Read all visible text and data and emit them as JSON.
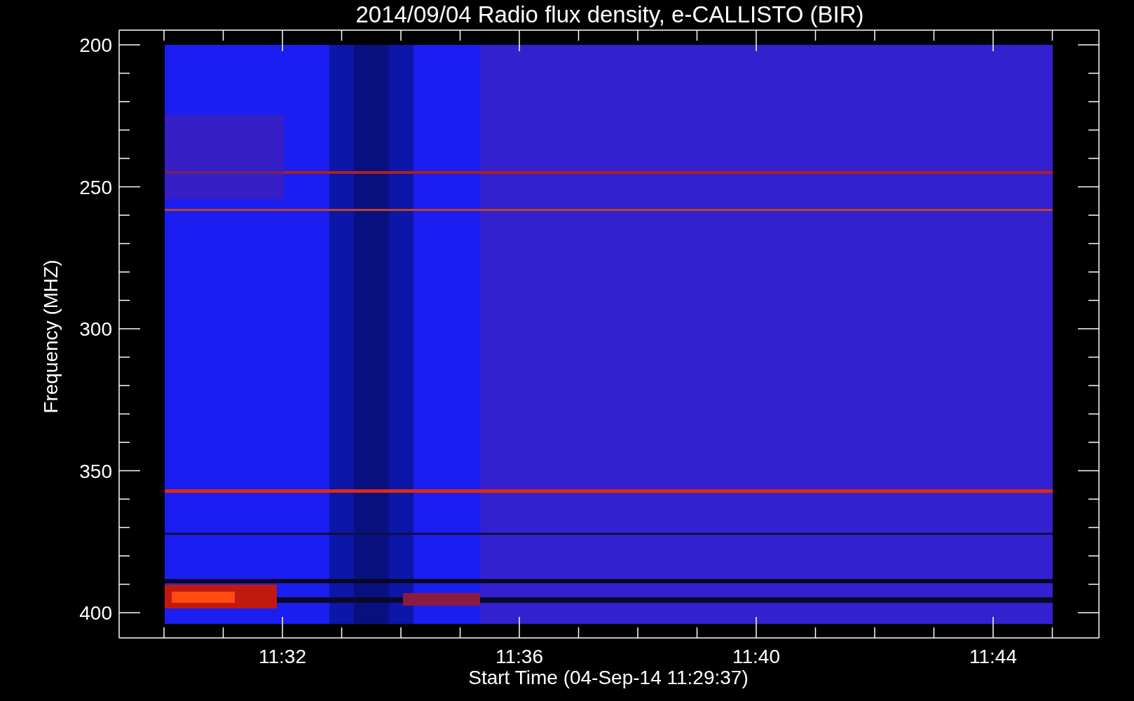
{
  "title": "2014/09/04  Radio flux density, e-CALLISTO (BIR)",
  "y_axis": {
    "label": "Frequency (MHZ)",
    "ticks": [
      "200",
      "250",
      "300",
      "350",
      "400"
    ]
  },
  "x_axis": {
    "label": "Start Time (04-Sep-14 11:29:37)",
    "ticks": [
      "11:32",
      "11:36",
      "11:40",
      "11:44"
    ]
  }
}
